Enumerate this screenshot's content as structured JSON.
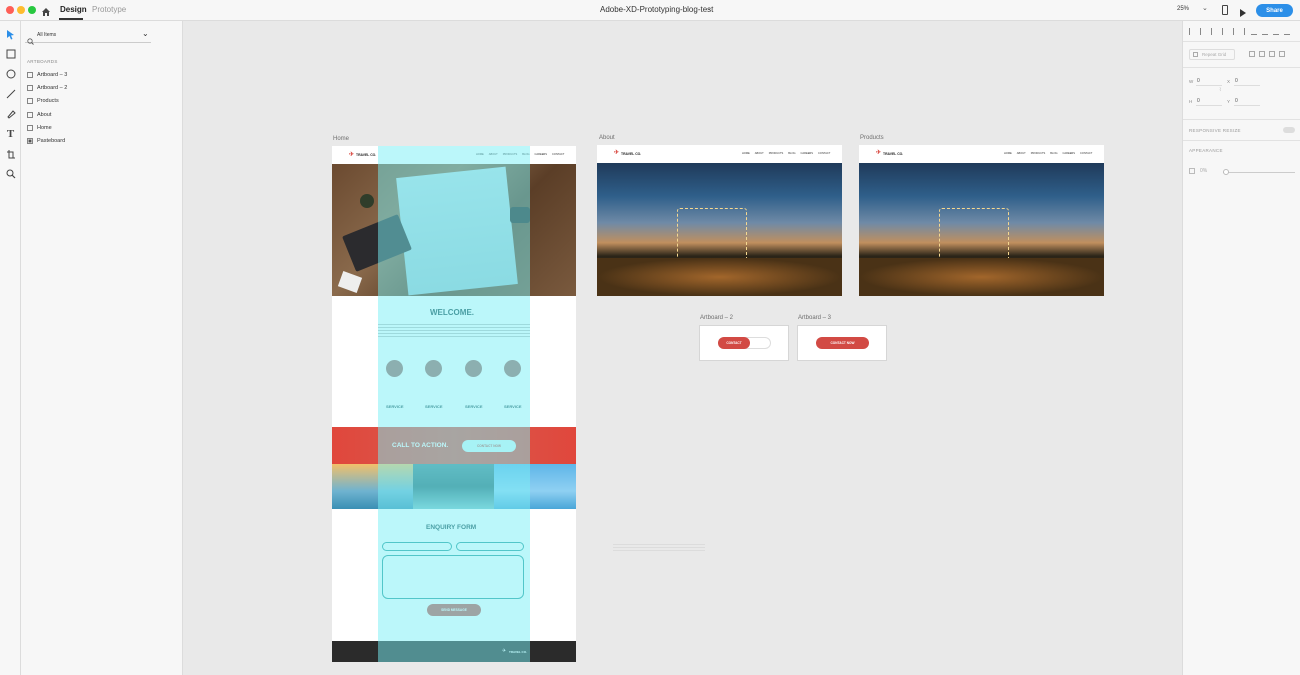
{
  "app": {
    "tabs": {
      "design": "Design",
      "prototype": "Prototype"
    },
    "document_title": "Adobe-XD-Prototyping-blog-test",
    "zoom": "25%",
    "share_label": "Share",
    "accent": "#2c8fe8"
  },
  "layers": {
    "filter_label": "All Items",
    "section_title": "ARTBOARDS",
    "items": [
      {
        "label": "Artboard – 3"
      },
      {
        "label": "Artboard – 2"
      },
      {
        "label": "Products"
      },
      {
        "label": "About"
      },
      {
        "label": "Home"
      },
      {
        "label": "Pasteboard"
      }
    ]
  },
  "properties": {
    "repeat_grid_label": "Repeat Grid",
    "w_label": "W",
    "w_value": "0",
    "x_label": "X",
    "x_value": "0",
    "h_label": "H",
    "h_value": "0",
    "y_label": "Y",
    "y_value": "0",
    "responsive_resize_label": "RESPONSIVE RESIZE",
    "appearance_label": "APPEARANCE",
    "opacity_value": "0%"
  },
  "artboards": {
    "home": {
      "label": "Home",
      "brand": "TRAVEL CO.",
      "nav": [
        "HOME",
        "ABOUT",
        "PRODUCTS",
        "BLOG",
        "CAREERS",
        "CONTACT"
      ],
      "welcome": "WELCOME.",
      "services": [
        "SERVICE",
        "SERVICE",
        "SERVICE",
        "SERVICE"
      ],
      "cta_text": "CALL TO ACTION.",
      "cta_button": "CONTACT NOW",
      "enquiry_title": "ENQUIRY FORM",
      "send_button": "SEND MESSAGE"
    },
    "about": {
      "label": "About",
      "brand": "TRAVEL CO."
    },
    "products": {
      "label": "Products",
      "brand": "TRAVEL CO."
    },
    "artboard2": {
      "label": "Artboard – 2",
      "button": "CONTACT"
    },
    "artboard3": {
      "label": "Artboard – 3",
      "button": "CONTACT NOW"
    }
  }
}
